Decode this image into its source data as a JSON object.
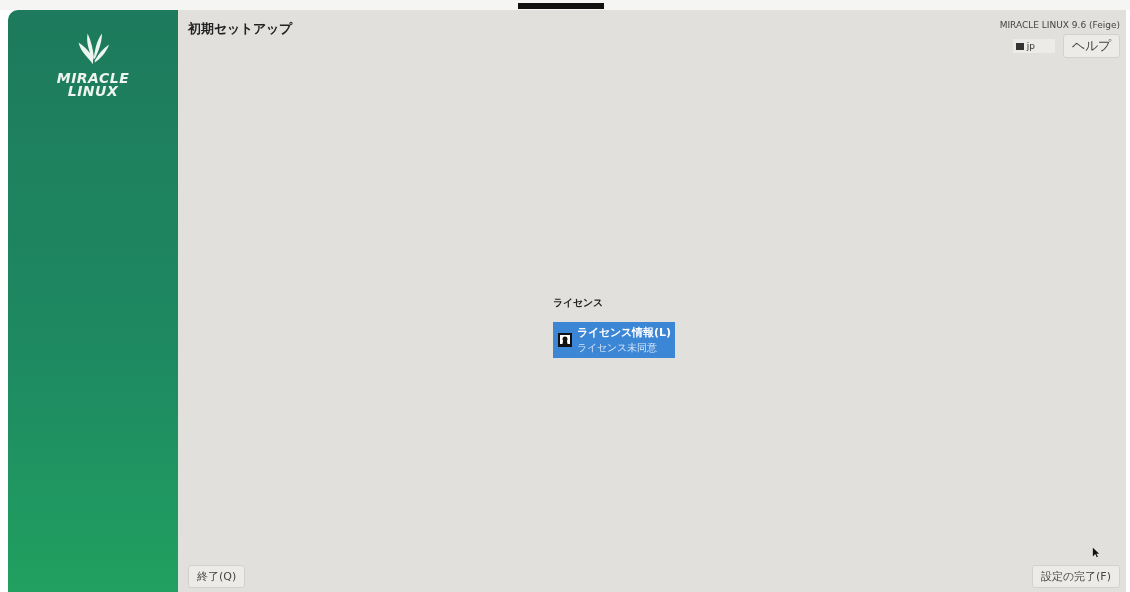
{
  "sidebar": {
    "logo_line1": "MIRACLE",
    "logo_line2": "LINUX"
  },
  "header": {
    "title": "初期セットアップ",
    "product": "MIRACLE LINUX 9.6 (Feige)",
    "keyboard": "jp",
    "help": "ヘルプ"
  },
  "categories": [
    {
      "title": "ライセンス",
      "spokes": [
        {
          "title": "ライセンス情報(L)",
          "status": "ライセンス未同意",
          "selected": true
        }
      ]
    }
  ],
  "footer": {
    "quit": "終了(Q)",
    "finish": "設定の完了(F)"
  }
}
